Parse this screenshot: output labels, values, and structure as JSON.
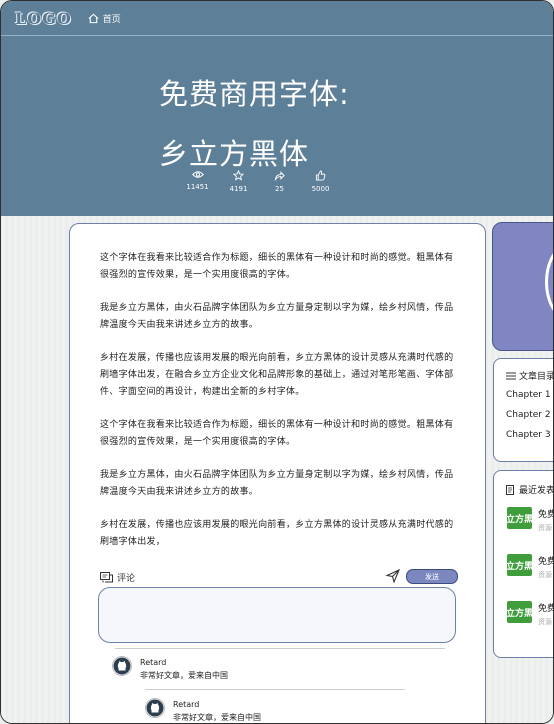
{
  "nav": {
    "logo": "LOGO",
    "home_label": "首页"
  },
  "hero": {
    "title_line1": "免费商用字体:",
    "title_line2": "乡立方黑体",
    "stats": [
      {
        "icon": "eye-icon",
        "value": "11451"
      },
      {
        "icon": "star-icon",
        "value": "4191"
      },
      {
        "icon": "share-icon",
        "value": "25"
      },
      {
        "icon": "thumbs-up-icon",
        "value": "5000"
      }
    ]
  },
  "article": {
    "paragraphs": [
      "这个字体在我看来比较适合作为标题，细长的黑体有一种设计和时尚的感觉。粗黑体有很强烈的宣传效果，是一个实用度很高的字体。",
      "我是乡立方黑体，由火石品牌字体团队为乡立方量身定制以字为媒，绘乡村风情，传品牌温度今天由我来讲述乡立方的故事。",
      "乡村在发展，传播也应该用发展的眼光向前看，乡立方黑体的设计灵感从充满时代感的刷墙字体出发，在融合乡立方企业文化和品牌形象的基础上，通过对笔形笔画、字体部件、字面空间的再设计，构建出全新的乡村字体。",
      "这个字体在我看来比较适合作为标题，细长的黑体有一种设计和时尚的感觉。粗黑体有很强烈的宣传效果，是一个实用度很高的字体。",
      "我是乡立方黑体，由火石品牌字体团队为乡立方量身定制以字为媒，绘乡村风情，传品牌温度今天由我来讲述乡立方的故事。",
      "乡村在发展，传播也应该用发展的眼光向前看，乡立方黑体的设计灵感从充满时代感的刷墙字体出发，"
    ]
  },
  "comments": {
    "header_label": "评论",
    "send_label": "发送",
    "input_placeholder": "",
    "items": [
      {
        "user": "Retard",
        "text": "非常好文章，爱来自中国"
      },
      {
        "user": "Retard",
        "text": "非常好文章，爱来自中国"
      }
    ]
  },
  "sidebar": {
    "toc": {
      "title": "文章目录",
      "items": [
        "Chapter 1",
        "Chapter 2",
        "Chapter 3"
      ]
    },
    "recent": {
      "title": "最近发表",
      "items": [
        {
          "thumb": "立方黑",
          "title": "免费",
          "sub": "资源"
        },
        {
          "thumb": "立方黑",
          "title": "免费",
          "sub": "资源"
        },
        {
          "thumb": "立方黑",
          "title": "免费",
          "sub": "资源"
        }
      ]
    }
  },
  "colors": {
    "header_bg": "#5d7f98",
    "accent": "#7b88bf",
    "card_border": "#6d7fa8",
    "thumb_green": "#3f9d3b"
  }
}
